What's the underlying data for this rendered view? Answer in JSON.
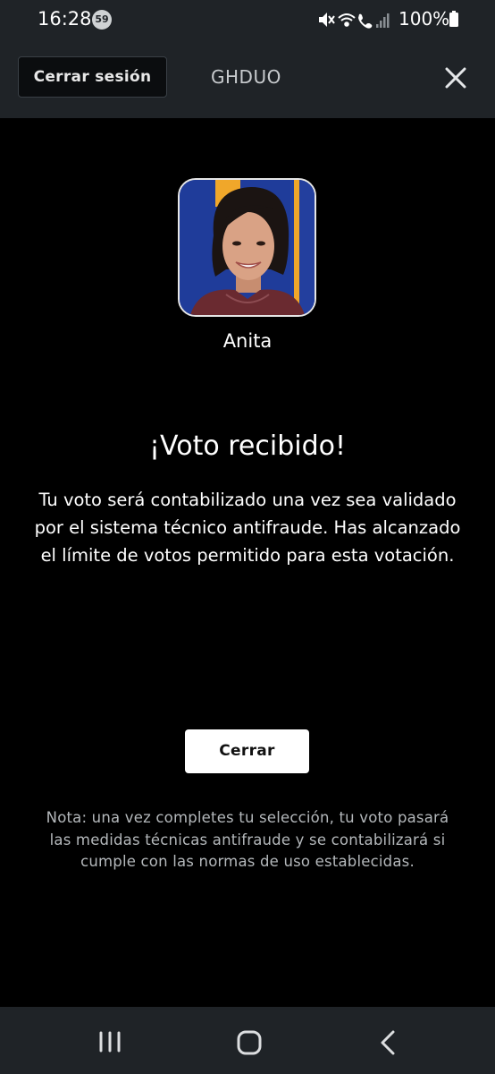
{
  "status_bar": {
    "time": "16:28",
    "notification_count": "59",
    "battery": "100%",
    "icons": [
      "mute-icon",
      "wifi-icon",
      "wifi-calling-icon",
      "signal-icon",
      "battery-icon"
    ]
  },
  "header": {
    "logout_label": "Cerrar sesión",
    "username": "GHDUO",
    "close_icon": "close-icon"
  },
  "contestant": {
    "name": "Anita"
  },
  "confirmation": {
    "title": "¡Voto recibido!",
    "message": "Tu voto será contabilizado una vez sea validado por el sistema técnico antifraude. Has alcanzado el límite de votos permitido para esta votación.",
    "close_label": "Cerrar",
    "note": "Nota: una vez completes tu selección, tu voto pasará las medidas técnicas antifraude y se contabilizará si cumple con las normas de uso establecidas."
  },
  "nav_bar": {
    "icons": [
      "recents-icon",
      "home-icon",
      "back-icon"
    ]
  },
  "colors": {
    "background": "#000000",
    "bar": "#1f2327",
    "avatar_bg": "#1f3c9a",
    "avatar_accent": "#f0a72a",
    "button": "#ffffff",
    "note_text": "#b4b8bb"
  }
}
